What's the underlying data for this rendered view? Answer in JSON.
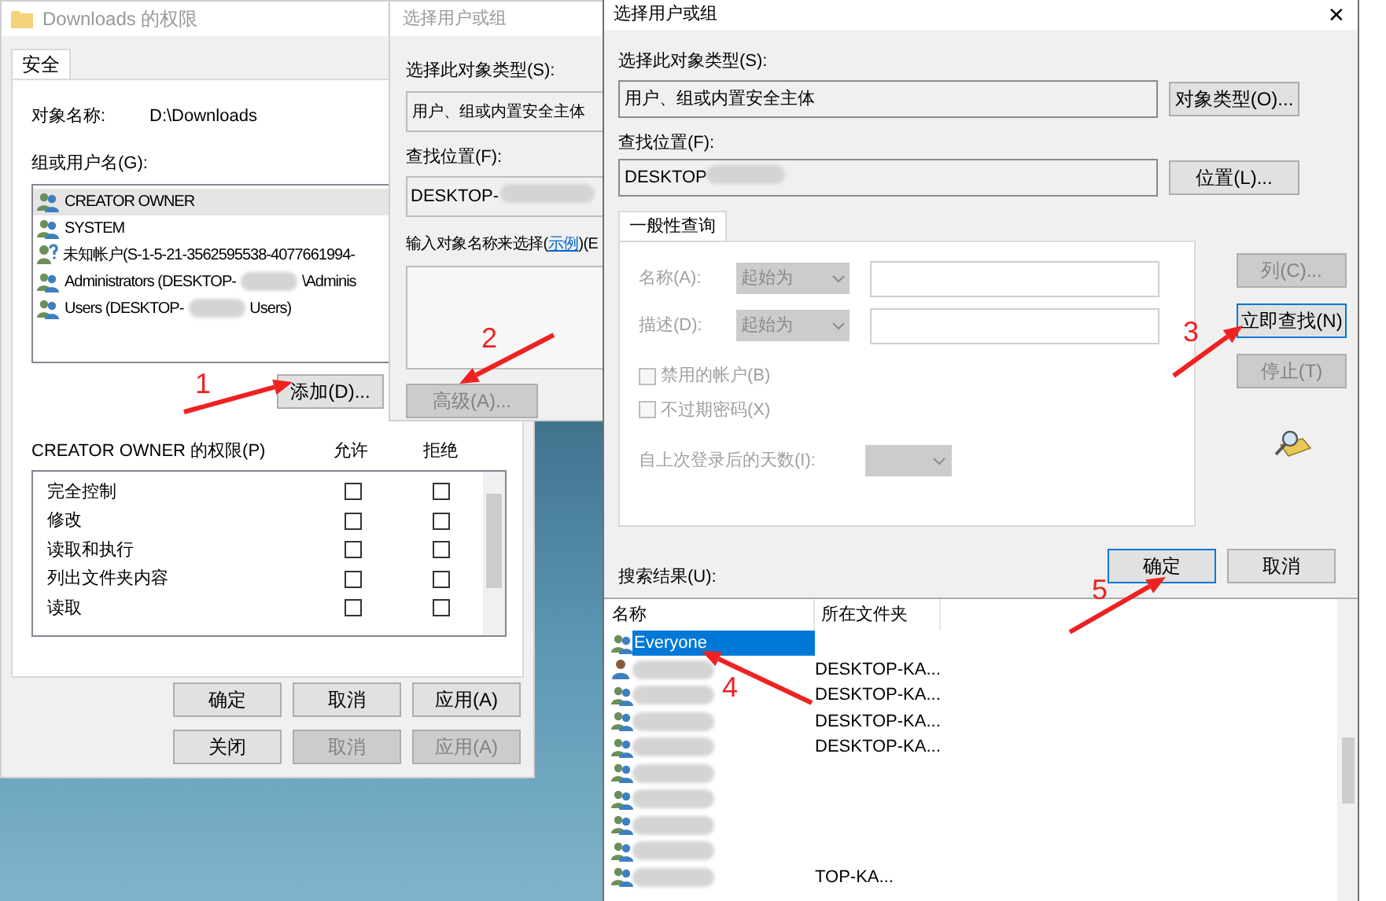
{
  "permissions_window": {
    "title": "Downloads 的权限",
    "tab": {
      "label": "安全",
      "selected": true
    },
    "object_label": "对象名称:",
    "object_value": "D:\\Downloads",
    "group_label": "组或用户名(G):",
    "principals": [
      {
        "kind": "group",
        "label": "CREATOR OWNER",
        "selected": true,
        "redacted": false
      },
      {
        "kind": "group",
        "label": "SYSTEM",
        "selected": false,
        "redacted": false
      },
      {
        "kind": "unknown",
        "label": "未知帐户(S-1-5-21-3562595538-4077661994-",
        "selected": false,
        "redacted": false
      },
      {
        "kind": "group",
        "label": "Administrators (DESKTOP-",
        "selected": false,
        "redacted": true,
        "label_end": "\\Adminis"
      },
      {
        "kind": "group",
        "label": "Users (DESKTOP-",
        "selected": false,
        "redacted": true,
        "label_end": "Users)"
      }
    ],
    "add_button": {
      "label": "添加(D)..."
    },
    "perm_label": "CREATOR OWNER 的权限(P)",
    "allow_header": "允许",
    "deny_header": "拒绝",
    "permissions": [
      {
        "label": "完全控制",
        "allow": false,
        "deny": false
      },
      {
        "label": "修改",
        "allow": false,
        "deny": false
      },
      {
        "label": "读取和执行",
        "allow": false,
        "deny": false
      },
      {
        "label": "列出文件夹内容",
        "allow": false,
        "deny": false
      },
      {
        "label": "读取",
        "allow": false,
        "deny": false
      }
    ],
    "buttons": [
      {
        "label": "确定",
        "disabled": false
      },
      {
        "label": "取消",
        "disabled": false
      },
      {
        "label": "应用(A)",
        "disabled": false
      }
    ],
    "outer_buttons": [
      {
        "label": "关闭",
        "disabled": false
      },
      {
        "label": "取消",
        "disabled": true
      },
      {
        "label": "应用(A)",
        "disabled": true
      }
    ]
  },
  "back_dialog": {
    "title": "选择用户或组",
    "type_label": "选择此对象类型(S):",
    "type_value": "用户、组或内置安全主体",
    "location_label": "查找位置(F):",
    "location_value": "DESKTOP-",
    "enter_prefix": "输入对象名称来选择(",
    "enter_link": "示例",
    "enter_suffix": ")(E",
    "advanced_button": {
      "label": "高级(A)...",
      "disabled": true
    }
  },
  "front_dialog": {
    "title": "选择用户或组",
    "close": "✕",
    "type_label": "选择此对象类型(S):",
    "type_value": "用户、组或内置安全主体",
    "type_button": "对象类型(O)...",
    "location_label": "查找位置(F):",
    "location_value": "DESKTOP",
    "location_button": "位置(L)...",
    "query_tab": {
      "label": "一般性查询",
      "selected": true
    },
    "name_label": "名称(A):",
    "name_mode": "起始为",
    "desc_label": "描述(D):",
    "desc_mode": "起始为",
    "checks": [
      {
        "label": "禁用的帐户(B)",
        "checked": false
      },
      {
        "label": "不过期密码(X)",
        "checked": false
      }
    ],
    "days_label": "自上次登录后的天数(I):",
    "side_buttons": [
      {
        "label": "列(C)...",
        "disabled": true,
        "focused": false
      },
      {
        "label": "立即查找(N)",
        "disabled": false,
        "focused": true
      },
      {
        "label": "停止(T)",
        "disabled": true,
        "focused": false
      }
    ],
    "ok_button": {
      "label": "确定",
      "focused": true
    },
    "cancel_button": {
      "label": "取消",
      "focused": false
    },
    "results_label": "搜索结果(U):",
    "columns": [
      "名称",
      "所在文件夹"
    ],
    "results": [
      {
        "kind": "group",
        "name": "Everyone",
        "selected": true
      },
      {
        "kind": "user",
        "folder": "DESKTOP-KA...",
        "selected": false
      },
      {
        "kind": "group",
        "folder": "DESKTOP-KA...",
        "selected": false
      },
      {
        "kind": "group",
        "folder": "DESKTOP-KA...",
        "selected": false
      },
      {
        "kind": "group",
        "folder": "DESKTOP-KA...",
        "selected": false
      },
      {
        "kind": "group",
        "selected": false
      },
      {
        "kind": "group",
        "selected": false
      },
      {
        "kind": "group",
        "selected": false
      },
      {
        "kind": "group",
        "selected": false
      },
      {
        "kind": "group",
        "folder": "TOP-KA...",
        "selected": false
      }
    ]
  },
  "annotations": [
    {
      "label": "1"
    },
    {
      "label": "2"
    },
    {
      "label": "3"
    },
    {
      "label": "4"
    },
    {
      "label": "5"
    }
  ]
}
